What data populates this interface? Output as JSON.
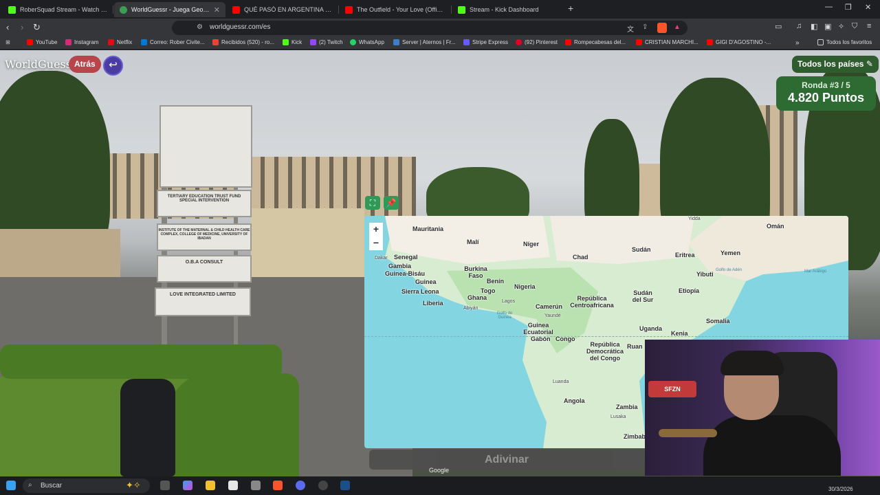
{
  "browser": {
    "tabs": [
      {
        "title": "RoberSquad Stream - Watch Live",
        "active": false,
        "icon": "kick-icon",
        "color": "#53fc18"
      },
      {
        "title": "WorldGuessr - Juega GeoGuessr",
        "active": true,
        "icon": "globe-icon",
        "color": "#3a9e54"
      },
      {
        "title": "QUÉ PASÓ EN ARGENTINA EN FEBR",
        "active": false,
        "icon": "youtube-icon",
        "color": "#ff0000"
      },
      {
        "title": "The Outfield - Your Love (Official",
        "active": false,
        "icon": "youtube-icon",
        "color": "#ff0000"
      },
      {
        "title": "Stream - Kick Dashboard",
        "active": false,
        "icon": "kick-icon",
        "color": "#53fc18"
      }
    ],
    "url": "worldguessr.com/es",
    "bookmarks": [
      {
        "label": "YouTube",
        "color": "#ff0000"
      },
      {
        "label": "Instagram",
        "color": "#d62976"
      },
      {
        "label": "Netflix",
        "color": "#e50914"
      },
      {
        "label": "Correo: Rober Civite...",
        "color": "#0078d4"
      },
      {
        "label": "Recibidos (520) - ro...",
        "color": "#ea4335"
      },
      {
        "label": "Kick",
        "color": "#53fc18"
      },
      {
        "label": "(2) Twitch",
        "color": "#9146ff"
      },
      {
        "label": "WhatsApp",
        "color": "#25d366"
      },
      {
        "label": "Server | Aternos | Fr...",
        "color": "#3d7ec9"
      },
      {
        "label": "Stripe Express",
        "color": "#635bff"
      },
      {
        "label": "(92) Pinterest",
        "color": "#e60023"
      },
      {
        "label": "Rompecabesas del...",
        "color": "#ff0000"
      },
      {
        "label": "CRISTIAN MARCHI...",
        "color": "#ff0000"
      },
      {
        "label": "GIGI D'AGOSTINO -...",
        "color": "#ff0000"
      }
    ],
    "all_bookmarks_label": "Todos los favoritos"
  },
  "game": {
    "logo": "WorldGuessr",
    "back_label": "Atrás",
    "countries_label": "Todos los países",
    "round_label": "Ronda #3 / 5",
    "points_label": "4.820 Puntos",
    "guess_label": "Adivinar",
    "map_attribution": "Google"
  },
  "street_signs": [
    "TERTIARY EDUCATION TRUST FUND SPECIAL INTERVENTION",
    "INSTITUTE OF THE MATERNAL & CHILD HEALTH CARE COMPLEX, COLLEGE OF MEDICINE, UNIVERSITY OF IBADAN",
    "O.B.A CONSULT",
    "LOVE INTEGRATED LIMITED"
  ],
  "map_labels": {
    "countries": [
      "Mauritania",
      "Malí",
      "Níger",
      "Chad",
      "Sudán",
      "Eritrea",
      "Yemen",
      "Omán",
      "Senegal",
      "Gambia",
      "Guinea-Bisáu",
      "Burkina Faso",
      "Benín",
      "Nigeria",
      "Yibuti",
      "Guinea",
      "Sierra Leona",
      "Togo",
      "Ghana",
      "Liberia",
      "Camerún",
      "República Centroafricana",
      "Sudán del Sur",
      "Etiopía",
      "Somalia",
      "Guinea Ecuatorial",
      "Gabón",
      "Congo",
      "Uganda",
      "Kenia",
      "República Democrática del Congo",
      "Ruan",
      "Angola",
      "Zambia",
      "Zimbab"
    ],
    "cities": [
      "Yidda",
      "Dakar",
      "Lagos",
      "Abiyán",
      "Yaundé",
      "Luanda",
      "Lusaka"
    ],
    "seas": [
      "Golfo de Adén",
      "Mar Arábigo",
      "Golfo de Guinea"
    ]
  },
  "taskbar": {
    "search_label": "Buscar",
    "date_label": "30/3/2026"
  },
  "webcam": {
    "mic_label": "SFZN"
  }
}
